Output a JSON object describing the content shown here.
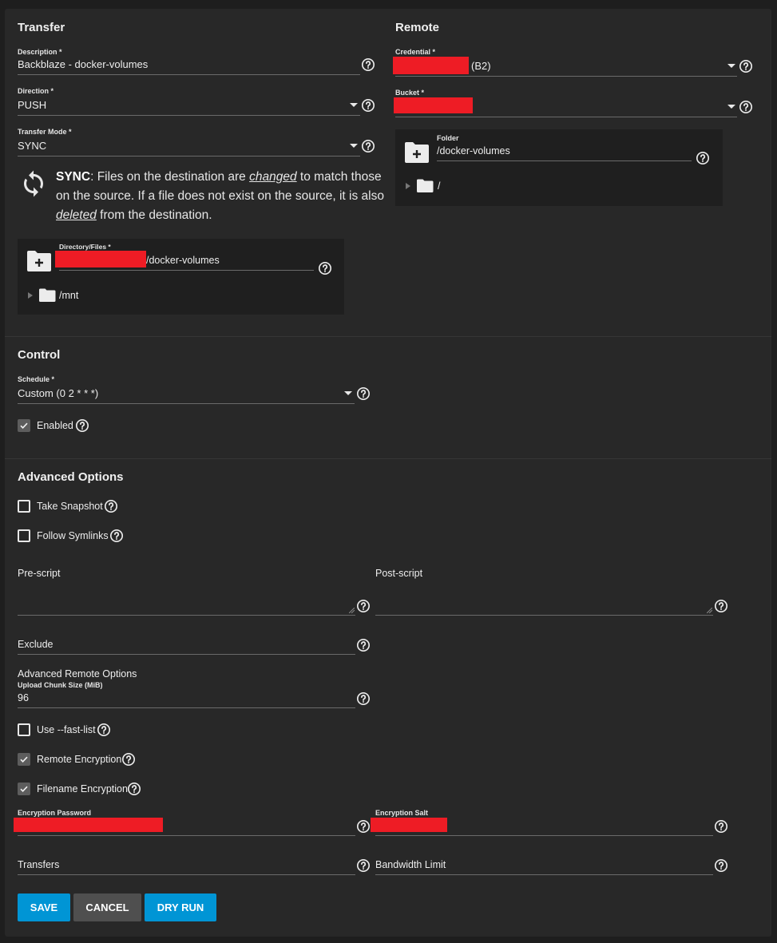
{
  "transfer": {
    "heading": "Transfer",
    "description": {
      "label": "Description *",
      "value": "Backblaze - docker-volumes"
    },
    "direction": {
      "label": "Direction *",
      "value": "PUSH"
    },
    "transfer_mode": {
      "label": "Transfer Mode *",
      "value": "SYNC"
    },
    "sync_note": {
      "title": "SYNC",
      "part1": ": Files on the destination are ",
      "em1": "changed",
      "part2": " to match those on the source. If a file does not exist on the source, it is also ",
      "em2": "deleted",
      "part3": " from the destination."
    },
    "directory_files": {
      "label": "Directory/Files *",
      "value_suffix": "/docker-volumes",
      "tree_root": "/mnt"
    }
  },
  "remote": {
    "heading": "Remote",
    "credential": {
      "label": "Credential *",
      "value_suffix": "(B2)"
    },
    "bucket": {
      "label": "Bucket *"
    },
    "folder": {
      "label": "Folder",
      "value": "/docker-volumes",
      "tree_root": "/"
    }
  },
  "control": {
    "heading": "Control",
    "schedule": {
      "label": "Schedule *",
      "value": "Custom (0 2 * * *)"
    },
    "enabled": {
      "label": "Enabled",
      "checked": true
    }
  },
  "advanced": {
    "heading": "Advanced Options",
    "take_snapshot": {
      "label": "Take Snapshot",
      "checked": false
    },
    "follow_symlinks": {
      "label": "Follow Symlinks",
      "checked": false
    },
    "pre_script": {
      "label": "Pre-script",
      "value": ""
    },
    "post_script": {
      "label": "Post-script",
      "value": ""
    },
    "exclude": {
      "label": "Exclude",
      "value": ""
    },
    "remote_options_heading": "Advanced Remote Options",
    "upload_chunk": {
      "label": "Upload Chunk Size (MiB)",
      "value": "96"
    },
    "fast_list": {
      "label": "Use --fast-list",
      "checked": false
    },
    "remote_encryption": {
      "label": "Remote Encryption",
      "checked": true
    },
    "filename_encryption": {
      "label": "Filename Encryption",
      "checked": true
    },
    "encryption_password": {
      "label": "Encryption Password"
    },
    "encryption_salt": {
      "label": "Encryption Salt"
    },
    "transfers": {
      "label": "Transfers",
      "value": ""
    },
    "bandwidth_limit": {
      "label": "Bandwidth Limit",
      "value": ""
    }
  },
  "buttons": {
    "save": "SAVE",
    "cancel": "CANCEL",
    "dry_run": "DRY RUN"
  },
  "colors": {
    "primary": "#0095d5",
    "background": "#282828",
    "redaction": "#ee1c25"
  },
  "icons": [
    "help-icon",
    "dropdown-caret-icon",
    "sync-icon",
    "folder-add-icon",
    "folder-icon",
    "check-icon"
  ]
}
